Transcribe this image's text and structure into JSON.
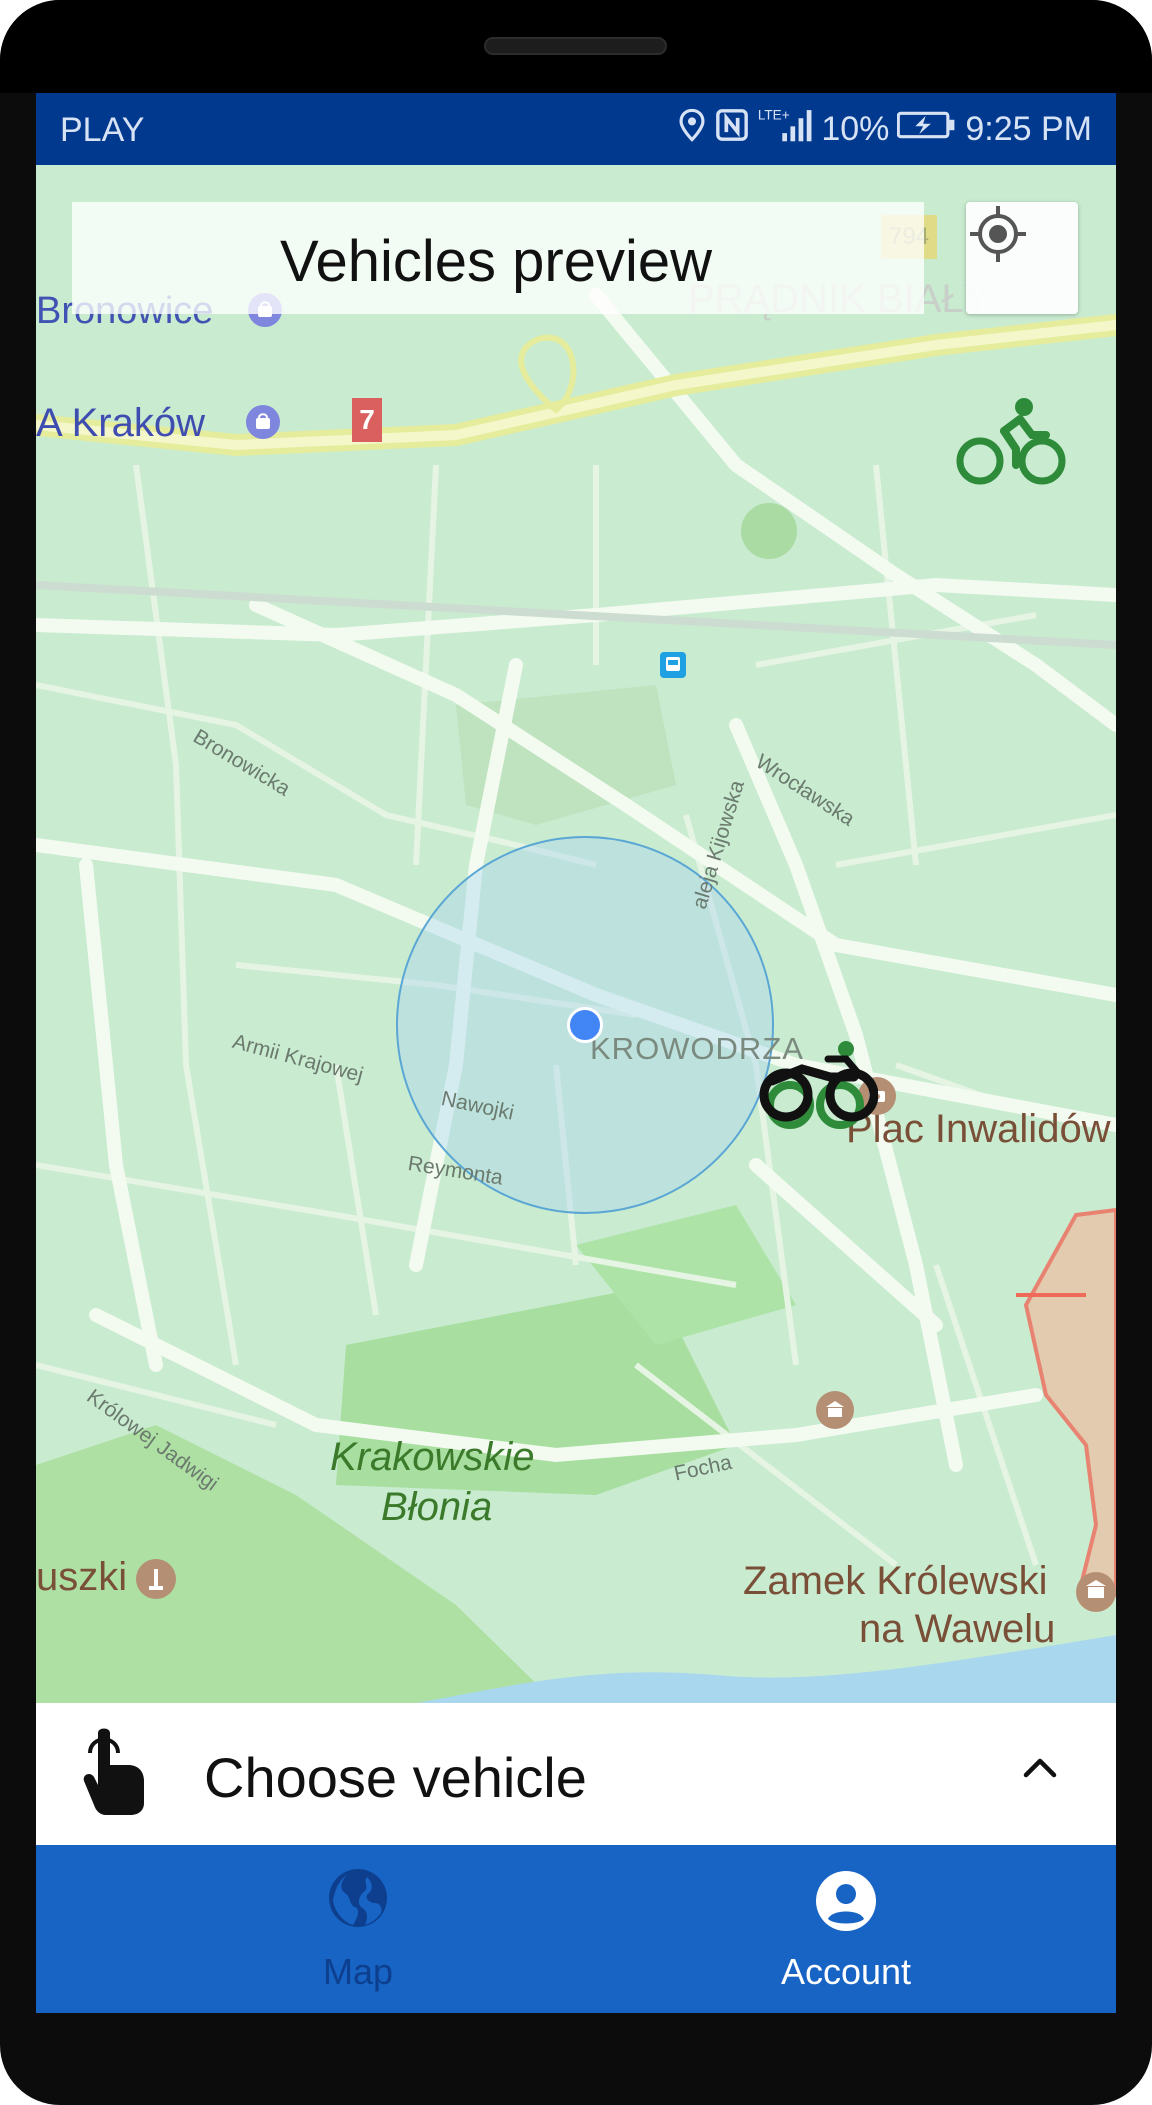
{
  "status_bar": {
    "carrier": "PLAY",
    "battery": "10%",
    "time": "9:25 PM",
    "icons": [
      "location-icon",
      "nfc-icon",
      "lte-signal-icon",
      "battery-charging-icon"
    ]
  },
  "header": {
    "title": "Vehicles preview",
    "locate_button_icon": "gps-crosshair-icon"
  },
  "map": {
    "labels": {
      "bronowice": "Bronowice",
      "prÄ…dnik": "PRĄDNIK BIAŁY",
      "krakow": "A Kraków",
      "route_7": "7",
      "route_794": "794",
      "bronowicka": "Bronowicka",
      "wroclawska": "Wrocławska",
      "kijowska": "aleja Kijowska",
      "armii": "Armii Krajowej",
      "nawojki": "Nawojki",
      "reymonta": "Reymonta",
      "krowodrza": "KROWODRZA",
      "plac": "Plac Inwalidów",
      "krolowej": "Królowej Jadwigi",
      "blonia_1": "Krakowskie",
      "blonia_2": "Błonia",
      "focha": "Focha",
      "uszki": "uszki",
      "zamek_1": "Zamek Królewski",
      "zamek_2": "na Wawelu"
    },
    "markers": [
      "bicycle-icon",
      "motorcycle-icon",
      "user-location-dot"
    ]
  },
  "chooser": {
    "label": "Choose vehicle",
    "icon": "tap-hand-icon",
    "toggle_icon": "chevron-up-icon"
  },
  "bottom_nav": {
    "items": [
      {
        "label": "Map",
        "icon": "globe-icon",
        "active": false
      },
      {
        "label": "Account",
        "icon": "account-circle-icon",
        "active": true
      }
    ]
  },
  "colors": {
    "status_bar": "#01398f",
    "nav_bar": "#1764c5",
    "nav_inactive": "#0d3f8e",
    "nav_active": "#ffffff",
    "map_base": "#c9ebd0",
    "bike_marker": "#2e8b3a"
  }
}
